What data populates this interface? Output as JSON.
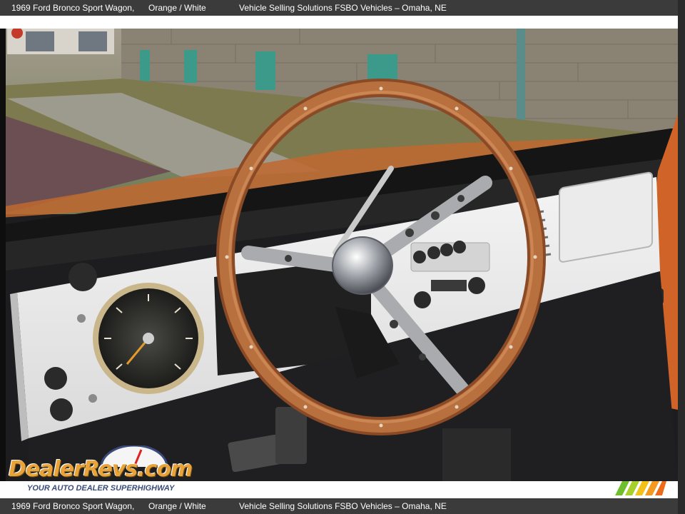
{
  "caption": {
    "title": "1969 Ford Bronco Sport Wagon,",
    "color": "Orange / White",
    "dealer": "Vehicle Selling Solutions FSBO Vehicles – Omaha, NE"
  },
  "photo": {
    "subject": "Steering wheel and dashboard",
    "colors": {
      "wood": "#b0643a",
      "dash": "#ececec",
      "paint": "#d0632c"
    }
  },
  "watermark": {
    "logo_text": "DealerRevs.com",
    "tagline": "YOUR AUTO DEALER SUPERHIGHWAY"
  },
  "brand_stripe_colors": [
    "#6fbf2c",
    "#a8cf2a",
    "#f2c218",
    "#f39a1e",
    "#ee6a1b"
  ]
}
